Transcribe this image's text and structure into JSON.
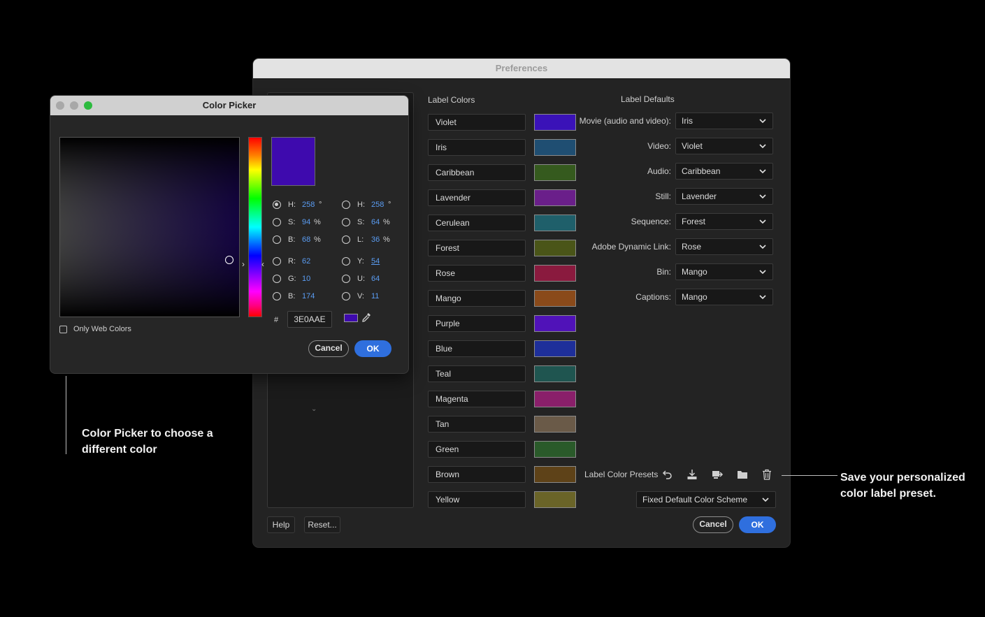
{
  "preferences": {
    "title": "Preferences",
    "label_colors_heading": "Label Colors",
    "label_defaults_heading": "Label Defaults",
    "label_colors": [
      {
        "name": "Violet",
        "color": "#3a12b8"
      },
      {
        "name": "Iris",
        "color": "#1f4e72"
      },
      {
        "name": "Caribbean",
        "color": "#355a1e"
      },
      {
        "name": "Lavender",
        "color": "#6a1f8a"
      },
      {
        "name": "Cerulean",
        "color": "#1f5f6a"
      },
      {
        "name": "Forest",
        "color": "#4a5518"
      },
      {
        "name": "Rose",
        "color": "#8a1a3e"
      },
      {
        "name": "Mango",
        "color": "#8a4a1a"
      },
      {
        "name": "Purple",
        "color": "#5012b8"
      },
      {
        "name": "Blue",
        "color": "#1e2f9a"
      },
      {
        "name": "Teal",
        "color": "#1f5550"
      },
      {
        "name": "Magenta",
        "color": "#8a1f6a"
      },
      {
        "name": "Tan",
        "color": "#6a5a48"
      },
      {
        "name": "Green",
        "color": "#2a5a2a"
      },
      {
        "name": "Brown",
        "color": "#5e4218"
      },
      {
        "name": "Yellow",
        "color": "#6a6428"
      }
    ],
    "label_defaults": [
      {
        "label": "Movie (audio and video):",
        "value": "Iris"
      },
      {
        "label": "Video:",
        "value": "Violet"
      },
      {
        "label": "Audio:",
        "value": "Caribbean"
      },
      {
        "label": "Still:",
        "value": "Lavender"
      },
      {
        "label": "Sequence:",
        "value": "Forest"
      },
      {
        "label": "Adobe Dynamic Link:",
        "value": "Rose"
      },
      {
        "label": "Bin:",
        "value": "Mango"
      },
      {
        "label": "Captions:",
        "value": "Mango"
      }
    ],
    "presets_label": "Label Color Presets",
    "preset_icons": [
      "undo-icon",
      "import-icon",
      "export-icon",
      "folder-icon",
      "trash-icon"
    ],
    "scheme_value": "Fixed Default Color Scheme",
    "help_label": "Help",
    "reset_label": "Reset...",
    "cancel_label": "Cancel",
    "ok_label": "OK"
  },
  "picker": {
    "title": "Color Picker",
    "hsb": [
      {
        "label": "H:",
        "value": "258",
        "unit": "°",
        "selected": true
      },
      {
        "label": "S:",
        "value": "94",
        "unit": "%",
        "selected": false
      },
      {
        "label": "B:",
        "value": "68",
        "unit": "%",
        "selected": false
      }
    ],
    "hsl": [
      {
        "label": "H:",
        "value": "258",
        "unit": "°"
      },
      {
        "label": "S:",
        "value": "64",
        "unit": "%"
      },
      {
        "label": "L:",
        "value": "36",
        "unit": "%"
      }
    ],
    "rgb": [
      {
        "label": "R:",
        "value": "62"
      },
      {
        "label": "G:",
        "value": "10"
      },
      {
        "label": "B:",
        "value": "174"
      }
    ],
    "yuv": [
      {
        "label": "Y:",
        "value": "54"
      },
      {
        "label": "U:",
        "value": "64"
      },
      {
        "label": "V:",
        "value": "11"
      }
    ],
    "hash_label": "#",
    "hex_value": "3E0AAE",
    "current_color": "#3e0aae",
    "only_web_colors_label": "Only Web Colors",
    "cancel_label": "Cancel",
    "ok_label": "OK"
  },
  "annotations": {
    "left_line1": "Color Picker to choose a",
    "left_line2": "different color",
    "right_line1": "Save your personalized",
    "right_line2": "color label preset."
  },
  "colors": {
    "accent": "#2f6fde",
    "value_blue": "#5a9cf2"
  }
}
